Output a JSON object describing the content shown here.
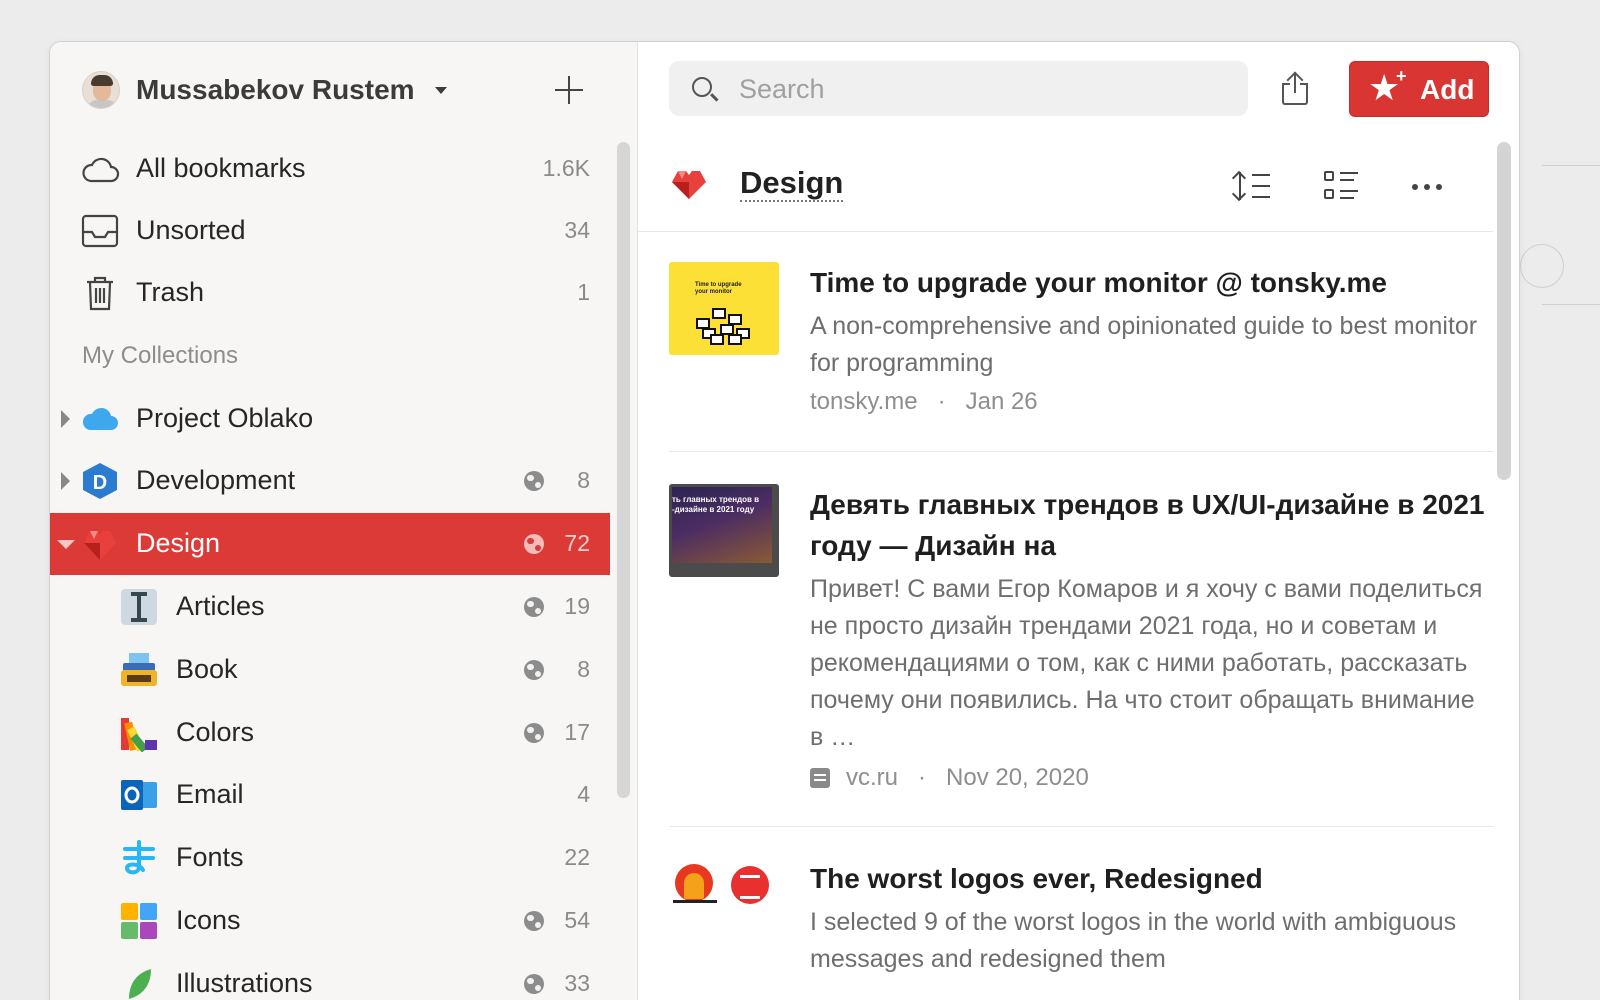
{
  "user": {
    "name": "Mussabekov Rustem"
  },
  "nav": [
    {
      "label": "All bookmarks",
      "count": "1.6K",
      "icon": "cloud-outline-icon"
    },
    {
      "label": "Unsorted",
      "count": "34",
      "icon": "inbox-icon"
    },
    {
      "label": "Trash",
      "count": "1",
      "icon": "trash-icon"
    }
  ],
  "section_title": "My Collections",
  "collections": [
    {
      "label": "Project Oblako",
      "count": "",
      "icon": "cloud-blue-icon",
      "shared": false
    },
    {
      "label": "Development",
      "count": "8",
      "icon": "d-badge-icon",
      "shared": true
    },
    {
      "label": "Design",
      "count": "72",
      "icon": "red-heart-icon",
      "shared": true,
      "active": true
    },
    {
      "label": "Articles",
      "count": "19",
      "icon": "text-cursor-icon",
      "shared": true,
      "sub": true
    },
    {
      "label": "Book",
      "count": "8",
      "icon": "typewriter-icon",
      "shared": true,
      "sub": true
    },
    {
      "label": "Colors",
      "count": "17",
      "icon": "color-swatches-icon",
      "shared": true,
      "sub": true
    },
    {
      "label": "Email",
      "count": "4",
      "icon": "outlook-icon",
      "shared": false,
      "sub": true
    },
    {
      "label": "Fonts",
      "count": "22",
      "icon": "ma-glyph-icon",
      "shared": false,
      "sub": true
    },
    {
      "label": "Icons",
      "count": "54",
      "icon": "icon-grid-icon",
      "shared": true,
      "sub": true
    },
    {
      "label": "Illustrations",
      "count": "33",
      "icon": "leaf-icon",
      "shared": true,
      "sub": true
    }
  ],
  "search": {
    "placeholder": "Search"
  },
  "toolbar": {
    "add_label": "Add"
  },
  "collection_header": {
    "title": "Design"
  },
  "bookmarks": [
    {
      "title": "Time to upgrade your monitor @ tonsky.me",
      "description": "A non-comprehensive and opinionated guide to best monitor for programming",
      "domain": "tonsky.me",
      "date": "Jan 26",
      "thumb_caption": "Time to upgrade your monitor"
    },
    {
      "title": "Девять главных трендов в UX/UI-дизайне в 2021 году — Дизайн на",
      "description": "Привет! С вами Егор Комаров и я хочу с вами поделиться не просто дизайн трендами 2021 года, но и советам и рекомендациями о том, как с ними работать, рассказать почему они появились. На что стоит обращать внимание в …",
      "domain": "vc.ru",
      "date": "Nov 20, 2020",
      "thumb_caption": "ть главных трендов в -дизайне в 2021 году"
    },
    {
      "title": "The worst logos ever, Redesigned",
      "description": "I selected 9 of the worst logos in the world with ambiguous messages and redesigned them",
      "domain": "",
      "date": ""
    }
  ],
  "colors": {
    "accent": "#dc3a37",
    "sidebar_bg": "#f7f6f5"
  }
}
